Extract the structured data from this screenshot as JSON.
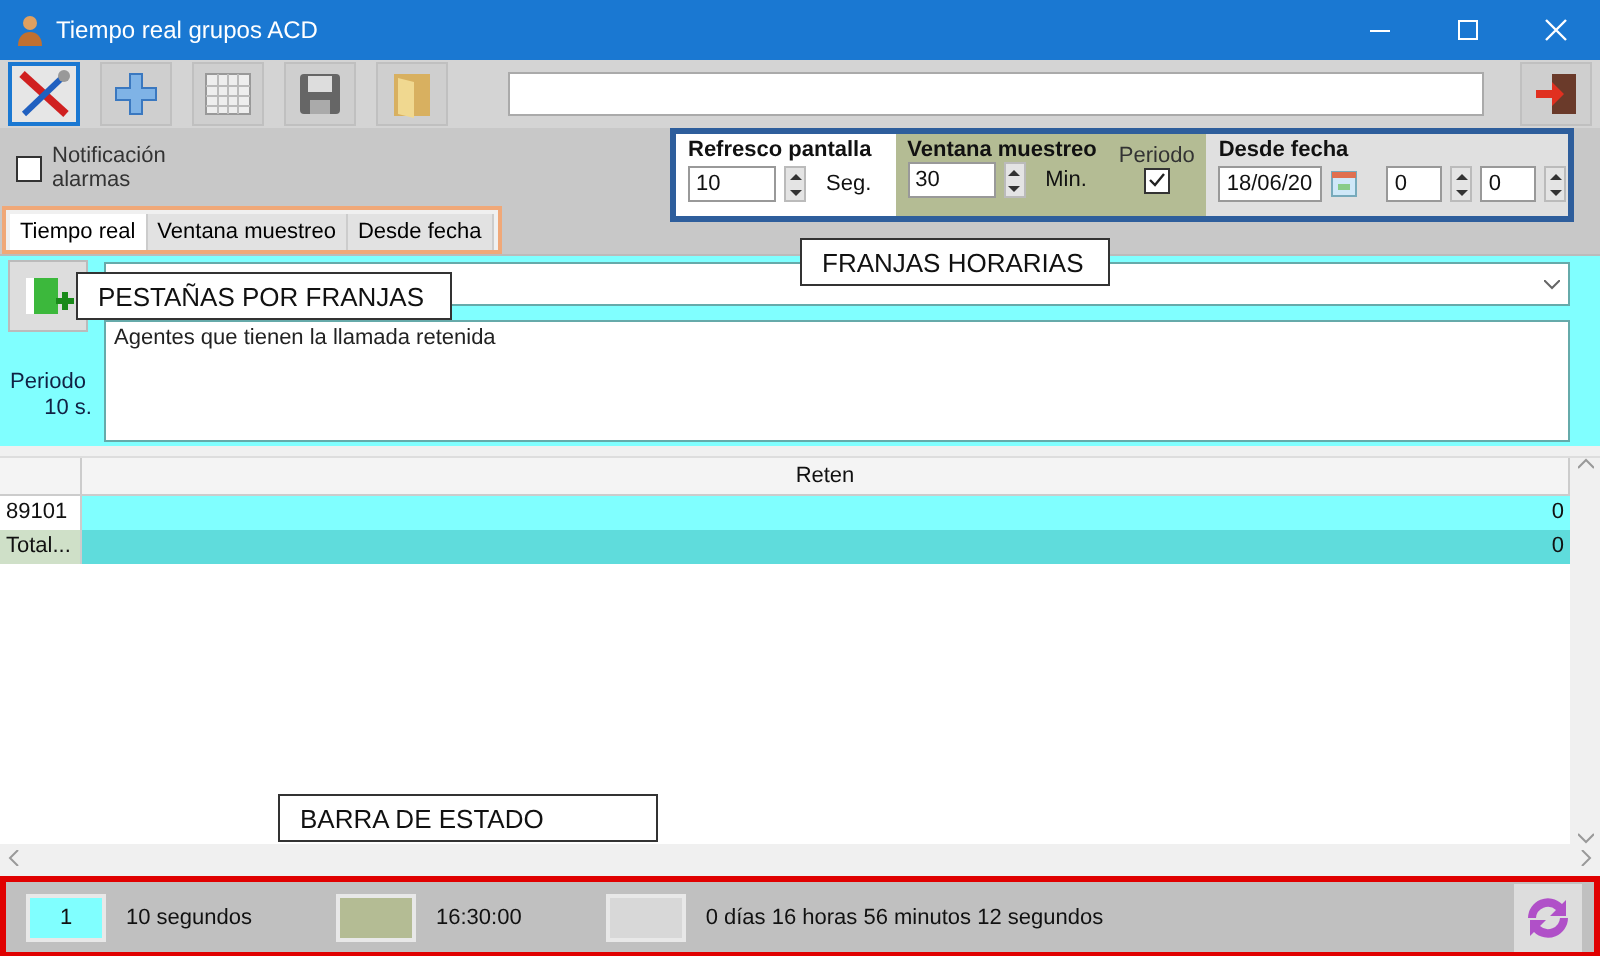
{
  "window": {
    "title": "Tiempo real grupos ACD"
  },
  "notification": {
    "label": "Notificación alarmas",
    "checked": false
  },
  "tabs": [
    {
      "label": "Tiempo real",
      "selected": true
    },
    {
      "label": "Ventana muestreo",
      "selected": false
    },
    {
      "label": "Desde fecha",
      "selected": false
    }
  ],
  "franjas": {
    "refresco": {
      "label": "Refresco pantalla",
      "value": "10",
      "unit": "Seg."
    },
    "ventana": {
      "label": "Ventana muestreo",
      "value": "30",
      "unit": "Min.",
      "periodo_label": "Periodo",
      "periodo_checked": true
    },
    "desde": {
      "label": "Desde fecha",
      "date": "18/06/20",
      "hour": "0",
      "minute": "0"
    }
  },
  "panel": {
    "periodo_label": "Periodo",
    "periodo_value": "10 s.",
    "description": "Agentes que tienen la llamada retenida"
  },
  "grid": {
    "columns": [
      "Reten"
    ],
    "rows": [
      {
        "kind": "row",
        "label": "89101",
        "value": "0"
      },
      {
        "kind": "total",
        "label": "Total...",
        "value": "0"
      }
    ]
  },
  "status_bar": {
    "items": [
      {
        "value": "1",
        "color": "#80ffff",
        "text": "10 segundos"
      },
      {
        "color": "#b4bc94",
        "text": "16:30:00"
      },
      {
        "color": "#d8d8d8",
        "text": "0 días 16 horas 56 minutos 12 segundos"
      }
    ]
  },
  "callouts": [
    {
      "text": "FRANJAS HORARIAS"
    },
    {
      "text": "PESTAÑAS POR FRANJAS"
    },
    {
      "text": "BARRA DE ESTADO"
    }
  ]
}
